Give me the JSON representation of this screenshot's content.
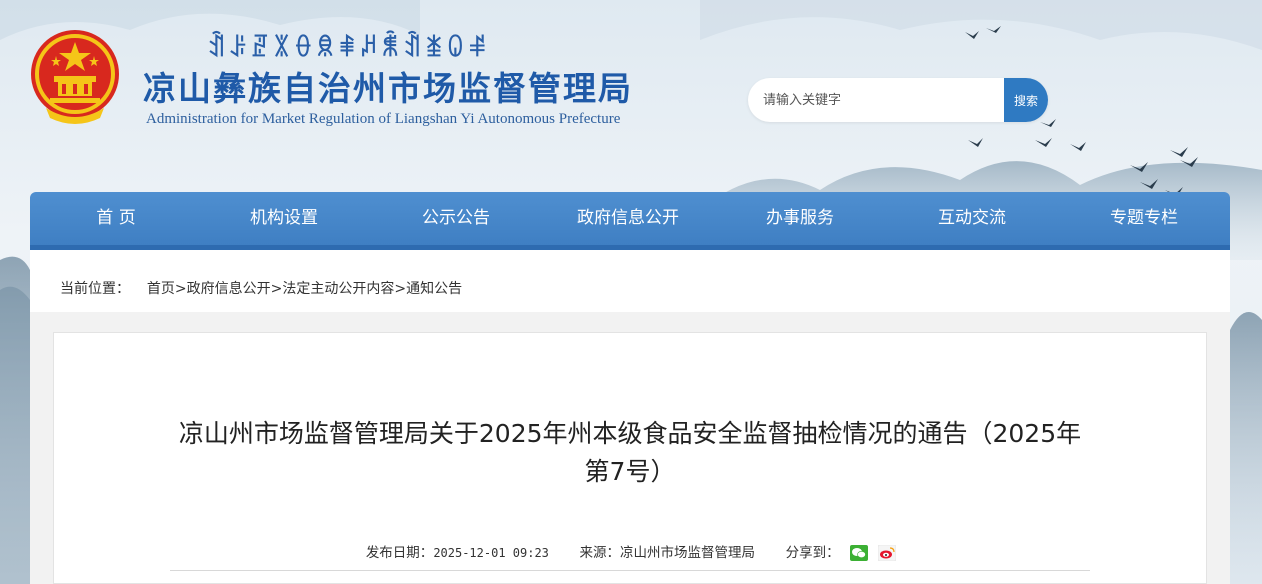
{
  "header": {
    "yi_script": "ꀉꌠꏣꇓꂷꌋꑌꈚꐨꀉꁧꐎꑷ",
    "title": "凉山彝族自治州市场监督管理局",
    "subtitle": "Administration for Market Regulation of Liangshan Yi Autonomous Prefecture",
    "search": {
      "placeholder": "请输入关键字",
      "button_label": "搜索"
    }
  },
  "nav": {
    "items": [
      {
        "label": "首 页"
      },
      {
        "label": "机构设置"
      },
      {
        "label": "公示公告"
      },
      {
        "label": "政府信息公开"
      },
      {
        "label": "办事服务"
      },
      {
        "label": "互动交流"
      },
      {
        "label": "专题专栏"
      }
    ]
  },
  "breadcrumb": {
    "prefix": "当前位置：",
    "items": [
      "首页",
      "政府信息公开",
      "法定主动公开内容",
      "通知公告"
    ],
    "separator": ">"
  },
  "article": {
    "title": "凉山州市场监督管理局关于2025年州本级食品安全监督抽检情况的通告（2025年第7号）",
    "publish_label": "发布日期：",
    "publish_date": "2025-12-01 09:23",
    "source_label": "来源：",
    "source": "凉山州市场监督管理局",
    "share_label": "分享到：",
    "share_icons": [
      "wechat-icon",
      "weibo-icon"
    ]
  },
  "colors": {
    "brand_blue": "#1f5aa8",
    "nav_blue": "#4f8fd0",
    "search_button": "#2f7ac2"
  }
}
